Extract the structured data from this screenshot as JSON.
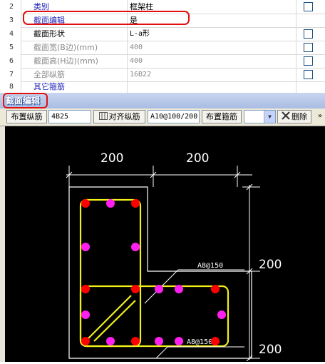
{
  "property_rows": [
    {
      "num": "2",
      "label": "类别",
      "value": "框架柱",
      "label_color": "blue",
      "checkbox": true
    },
    {
      "num": "3",
      "label": "截面编辑",
      "value": "是",
      "label_color": "blue",
      "checkbox": false
    },
    {
      "num": "4",
      "label": "截面形状",
      "value": "L-a形",
      "label_color": "black",
      "checkbox": true
    },
    {
      "num": "5",
      "label": "截面宽(B边)(mm)",
      "value": "400",
      "label_color": "gray",
      "checkbox": true
    },
    {
      "num": "6",
      "label": "截面高(H边)(mm)",
      "value": "400",
      "label_color": "gray",
      "checkbox": true
    },
    {
      "num": "7",
      "label": "全部纵筋",
      "value": "16B22",
      "label_color": "gray",
      "checkbox": true
    },
    {
      "num": "8",
      "label": "其它箍筋",
      "value": "",
      "label_color": "blue",
      "checkbox": false
    }
  ],
  "panel": {
    "title": "截面编辑",
    "toolbar": {
      "place_longitudinal": "布置纵筋",
      "longitudinal_value": "4B25",
      "align_longitudinal": "对齐纵筋",
      "stirrup_value": "A10@100/200",
      "place_stirrup": "布置箍筋",
      "delete": "删除",
      "more": "»"
    }
  },
  "drawing": {
    "dim_top_left": "200",
    "dim_top_right": "200",
    "dim_right_upper": "200",
    "dim_right_lower": "200",
    "stirrup_label_1": "A8@150",
    "stirrup_label_2": "A8@150"
  },
  "colors": {
    "label_blue": "#1f22b8",
    "highlight_red": "#e01010",
    "canvas_bg": "#000000",
    "stirrup_yellow": "#f2f01a",
    "corner_rebar": "#ff0000",
    "side_rebar": "#ff1ff0"
  }
}
